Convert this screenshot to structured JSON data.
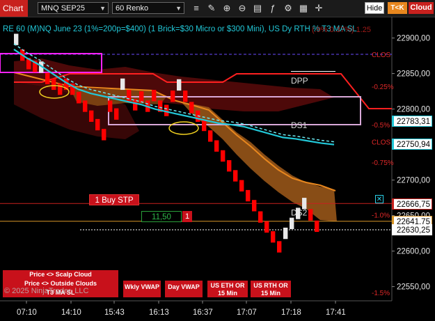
{
  "toolbar": {
    "tab_label": "Chart",
    "instrument": "MNQ SEP25",
    "bar_type": "60 Renko",
    "hide_label": "Hide",
    "tk_label": "T<K",
    "cloud_label": "Cloud",
    "icons": [
      "bar-style-icon",
      "drawing-tools-icon",
      "zoom-in-icon",
      "zoom-out-icon",
      "properties-icon",
      "indicators-icon",
      "strategies-icon",
      "data-box-icon",
      "crosshair-icon"
    ]
  },
  "chart": {
    "title": "RE 60 (M)NQ June 23 (1%=200p=$400) (1 Brick=$30 Micro or $300 Mini), US Dy RTH % T3 MA SL",
    "title_overlay": "(.9% 0.37%) 1.25",
    "y_axis": {
      "ticks": [
        "22900,00",
        "22850,00",
        "22800,00",
        "22750,00",
        "22700,00",
        "22650,00",
        "22600,00",
        "22550,00"
      ],
      "min": 22530,
      "max": 22930
    },
    "x_axis": {
      "ticks": [
        "07:10",
        "14:10",
        "15:43",
        "16:13",
        "16:37",
        "17:07",
        "17:18",
        "17:41"
      ]
    },
    "price_labels": [
      {
        "text": "22783,31",
        "value": 22783.31,
        "color": "#22c8d8"
      },
      {
        "text": "22750,94",
        "value": 22750.94,
        "color": "#22c8d8"
      },
      {
        "text": "22666,75",
        "value": 22666.75,
        "color": "#c8211e"
      },
      {
        "text": "22641,75",
        "value": 22641.75,
        "color": "#d89628"
      },
      {
        "text": "22630,25",
        "value": 22630.25,
        "color": "#ffffff"
      }
    ],
    "level_labels": [
      {
        "text": "CLOS",
        "value": 22877,
        "color": "#e02828"
      },
      {
        "text": "-0.25%",
        "value": 22832,
        "color": "#e02828"
      },
      {
        "text": "-0.5%",
        "value": 22778,
        "color": "#e02828"
      },
      {
        "text": "CLOS",
        "value": 22754,
        "color": "#e02828"
      },
      {
        "text": "-0.75%",
        "value": 22725,
        "color": "#e02828"
      },
      {
        "text": "-1.0%",
        "value": 22651,
        "color": "#e02828"
      },
      {
        "text": "-1.5%",
        "value": 22542,
        "color": "#e02828"
      }
    ],
    "zone_labels": [
      "DPP",
      "DS1",
      "DS2"
    ],
    "order": {
      "label": "1 Buy STP",
      "price_text": "11,50",
      "quantity": "1",
      "close_icon": "close-order-icon"
    },
    "buttons": {
      "scalp_cloud": "Price <> Scalp Cloud",
      "outside_clouds": "Price <> Outside Clouds",
      "t3_ma_sl": "T3 MA SL",
      "wkly_vwap": "Wkly VWAP",
      "day_vwap": "Day VWAP",
      "us_eth_or": "US ETH OR\n15 Min",
      "us_rth_or": "US RTH OR\n15 Min"
    },
    "copyright": "© 2025 NinjaTrader, LLC",
    "colors": {
      "up_brick": "#e8e8e8",
      "down_brick": "#ff0000",
      "fast_ma": "#22c8d8",
      "accent": "#c8211e",
      "cloud_orange": "#d08030",
      "cloud_red": "#5a0a0a"
    }
  },
  "chart_data": {
    "type": "renko",
    "bricks": [
      {
        "dir": "up",
        "open": 22890,
        "close": 22906
      },
      {
        "dir": "down",
        "open": 22884,
        "close": 22868
      },
      {
        "dir": "down",
        "open": 22872,
        "close": 22856
      },
      {
        "dir": "down",
        "open": 22868,
        "close": 22852
      },
      {
        "dir": "up",
        "open": 22851,
        "close": 22867
      },
      {
        "dir": "down",
        "open": 22851,
        "close": 22835
      },
      {
        "dir": "down",
        "open": 22843,
        "close": 22827
      },
      {
        "dir": "down",
        "open": 22836,
        "close": 22820
      },
      {
        "dir": "down",
        "open": 22843,
        "close": 22827
      },
      {
        "dir": "down",
        "open": 22836,
        "close": 22820
      },
      {
        "dir": "down",
        "open": 22824,
        "close": 22808
      },
      {
        "dir": "down",
        "open": 22812,
        "close": 22796
      },
      {
        "dir": "down",
        "open": 22798,
        "close": 22782
      },
      {
        "dir": "down",
        "open": 22786,
        "close": 22770
      },
      {
        "dir": "down",
        "open": 22772,
        "close": 22756
      },
      {
        "dir": "down",
        "open": 22812,
        "close": 22796
      },
      {
        "dir": "down",
        "open": 22801,
        "close": 22785
      },
      {
        "dir": "up",
        "open": 22827,
        "close": 22843
      },
      {
        "dir": "down",
        "open": 22827,
        "close": 22811
      },
      {
        "dir": "down",
        "open": 22814,
        "close": 22798
      },
      {
        "dir": "down",
        "open": 22825,
        "close": 22809
      },
      {
        "dir": "down",
        "open": 22812,
        "close": 22796
      },
      {
        "dir": "down",
        "open": 22827,
        "close": 22811
      },
      {
        "dir": "down",
        "open": 22812,
        "close": 22796
      },
      {
        "dir": "down",
        "open": 22806,
        "close": 22790
      },
      {
        "dir": "down",
        "open": 22826,
        "close": 22810
      },
      {
        "dir": "up",
        "open": 22826,
        "close": 22842
      },
      {
        "dir": "down",
        "open": 22826,
        "close": 22810
      },
      {
        "dir": "down",
        "open": 22810,
        "close": 22794
      },
      {
        "dir": "down",
        "open": 22798,
        "close": 22782
      },
      {
        "dir": "down",
        "open": 22785,
        "close": 22769
      },
      {
        "dir": "down",
        "open": 22770,
        "close": 22754
      },
      {
        "dir": "down",
        "open": 22756,
        "close": 22740
      },
      {
        "dir": "down",
        "open": 22742,
        "close": 22726
      },
      {
        "dir": "down",
        "open": 22728,
        "close": 22712
      },
      {
        "dir": "down",
        "open": 22714,
        "close": 22698
      },
      {
        "dir": "down",
        "open": 22700,
        "close": 22684
      },
      {
        "dir": "down",
        "open": 22686,
        "close": 22670
      },
      {
        "dir": "down",
        "open": 22672,
        "close": 22656
      },
      {
        "dir": "down",
        "open": 22656,
        "close": 22640
      },
      {
        "dir": "down",
        "open": 22642,
        "close": 22626
      },
      {
        "dir": "down",
        "open": 22628,
        "close": 22612
      },
      {
        "dir": "down",
        "open": 22614,
        "close": 22598
      },
      {
        "dir": "up",
        "open": 22617,
        "close": 22633
      },
      {
        "dir": "up",
        "open": 22631,
        "close": 22647
      },
      {
        "dir": "up",
        "open": 22645,
        "close": 22661
      },
      {
        "dir": "up",
        "open": 22659,
        "close": 22675
      },
      {
        "dir": "down",
        "open": 22659,
        "close": 22643
      },
      {
        "dir": "down",
        "open": 22643,
        "close": 22627
      }
    ],
    "series": [
      {
        "name": "T3 MA SL",
        "values": [
          22884,
          22872,
          22862,
          22850,
          22838,
          22828,
          22822,
          22818,
          22814,
          22810,
          22806,
          22800,
          22796,
          22792,
          22788,
          22784,
          22780,
          22778,
          22775,
          22770,
          22765,
          22760,
          22758,
          22755,
          22752,
          22750
        ]
      }
    ]
  }
}
